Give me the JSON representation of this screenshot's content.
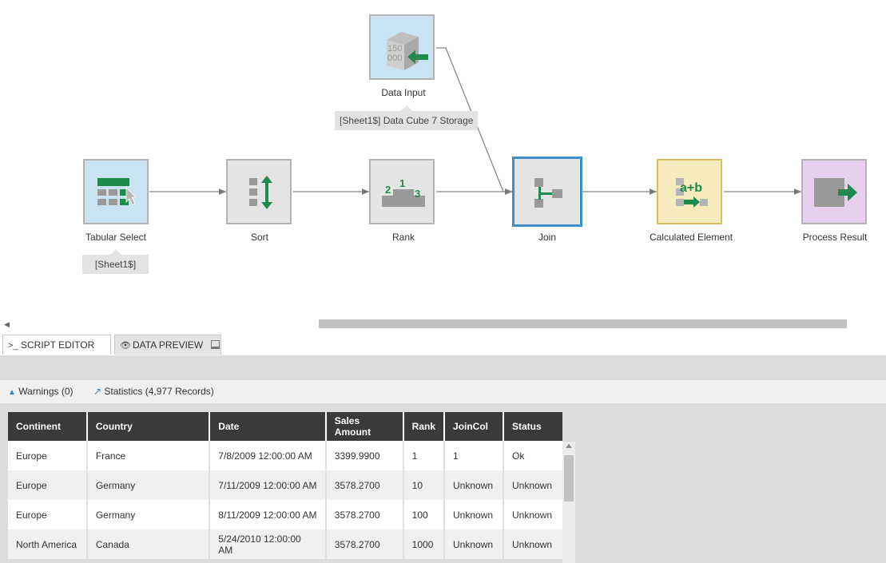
{
  "flow": {
    "nodes": [
      {
        "id": "tabular-select",
        "label": "Tabular Select",
        "tooltip": "[Sheet1$]"
      },
      {
        "id": "sort",
        "label": "Sort"
      },
      {
        "id": "rank",
        "label": "Rank",
        "icon_text": [
          "2",
          "1",
          "3"
        ]
      },
      {
        "id": "join",
        "label": "Join",
        "selected": true
      },
      {
        "id": "calculated-element",
        "label": "Calculated Element",
        "icon_text": "a+b"
      },
      {
        "id": "process-result",
        "label": "Process Result"
      },
      {
        "id": "data-input",
        "label": "Data Input",
        "tooltip": "[Sheet1$] Data Cube 7 Storage",
        "icon_text": [
          "150",
          "000"
        ]
      }
    ]
  },
  "tabs": [
    {
      "label": "SCRIPT EDITOR",
      "icon": "terminal-icon",
      "active": false
    },
    {
      "label": "DATA PREVIEW",
      "icon": "eye-icon",
      "active": true
    }
  ],
  "preview": {
    "warnings": "Warnings (0)",
    "statistics": "Statistics (4,977 Records)",
    "columns": [
      "Continent",
      "Country",
      "Date",
      "Sales Amount",
      "Rank",
      "JoinCol",
      "Status"
    ],
    "rows": [
      [
        "Europe",
        "France",
        "7/8/2009 12:00:00 AM",
        "3399.9900",
        "1",
        "1",
        "Ok"
      ],
      [
        "Europe",
        "Germany",
        "7/11/2009 12:00:00 AM",
        "3578.2700",
        "10",
        "Unknown",
        "Unknown"
      ],
      [
        "Europe",
        "Germany",
        "8/11/2009 12:00:00 AM",
        "3578.2700",
        "100",
        "Unknown",
        "Unknown"
      ],
      [
        "North America",
        "Canada",
        "5/24/2010 12:00:00 AM",
        "3578.2700",
        "1000",
        "Unknown",
        "Unknown"
      ]
    ]
  },
  "colors": {
    "accent_green": "#1e8a4c",
    "selected_border": "#3a8fcf",
    "header_dark": "#3a3a3a"
  }
}
